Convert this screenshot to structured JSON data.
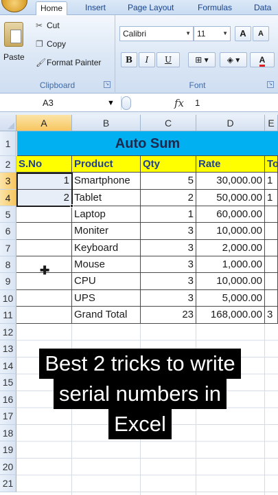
{
  "ribbon": {
    "tabs": [
      {
        "label": "Home",
        "active": true
      },
      {
        "label": "Insert",
        "active": false
      },
      {
        "label": "Page Layout",
        "active": false
      },
      {
        "label": "Formulas",
        "active": false
      },
      {
        "label": "Data",
        "active": false
      }
    ],
    "clipboard": {
      "paste_label": "Paste",
      "cut_label": "Cut",
      "copy_label": "Copy",
      "format_painter_label": "Format Painter",
      "group_label": "Clipboard"
    },
    "font": {
      "font_name": "Calibri",
      "font_size": "11",
      "grow_label": "A",
      "shrink_label": "A",
      "bold_label": "B",
      "italic_label": "I",
      "underline_label": "U",
      "color_label": "A",
      "group_label": "Font",
      "color_accent": "#e02020"
    }
  },
  "formula_bar": {
    "name_box": "A3",
    "fx_label": "fx",
    "value": "1"
  },
  "sheet": {
    "columns": [
      "A",
      "B",
      "C",
      "D",
      "E"
    ],
    "selected_column": "A",
    "rows": [
      "1",
      "2",
      "3",
      "4",
      "5",
      "6",
      "7",
      "8",
      "9",
      "10",
      "11",
      "12",
      "13",
      "14",
      "15",
      "16",
      "17",
      "18",
      "19",
      "20",
      "21"
    ],
    "selected_rows": [
      "3",
      "4"
    ],
    "title": "Auto Sum",
    "headers": {
      "a": "S.No",
      "b": "Product",
      "c": "Qty",
      "d": "Rate",
      "e": "To"
    },
    "data_rows": [
      {
        "sno": "1",
        "product": "Smartphone",
        "qty": "5",
        "rate": "30,000.00",
        "total": "1"
      },
      {
        "sno": "2",
        "product": "Tablet",
        "qty": "2",
        "rate": "50,000.00",
        "total": "1"
      },
      {
        "sno": "",
        "product": "Laptop",
        "qty": "1",
        "rate": "60,000.00",
        "total": ""
      },
      {
        "sno": "",
        "product": "Moniter",
        "qty": "3",
        "rate": "10,000.00",
        "total": ""
      },
      {
        "sno": "",
        "product": "Keyboard",
        "qty": "3",
        "rate": "2,000.00",
        "total": ""
      },
      {
        "sno": "",
        "product": "Mouse",
        "qty": "3",
        "rate": "1,000.00",
        "total": ""
      },
      {
        "sno": "",
        "product": "CPU",
        "qty": "3",
        "rate": "10,000.00",
        "total": ""
      },
      {
        "sno": "",
        "product": "UPS",
        "qty": "3",
        "rate": "5,000.00",
        "total": ""
      }
    ],
    "grand_total": {
      "label": "Grand Total",
      "qty": "23",
      "rate": "168,000.00",
      "total": "3"
    },
    "title_color": "#00b0f0",
    "header_color": "#ffff00"
  },
  "overlay": {
    "lines": [
      "Best 2 tricks to write",
      "serial numbers in",
      "Excel"
    ]
  }
}
